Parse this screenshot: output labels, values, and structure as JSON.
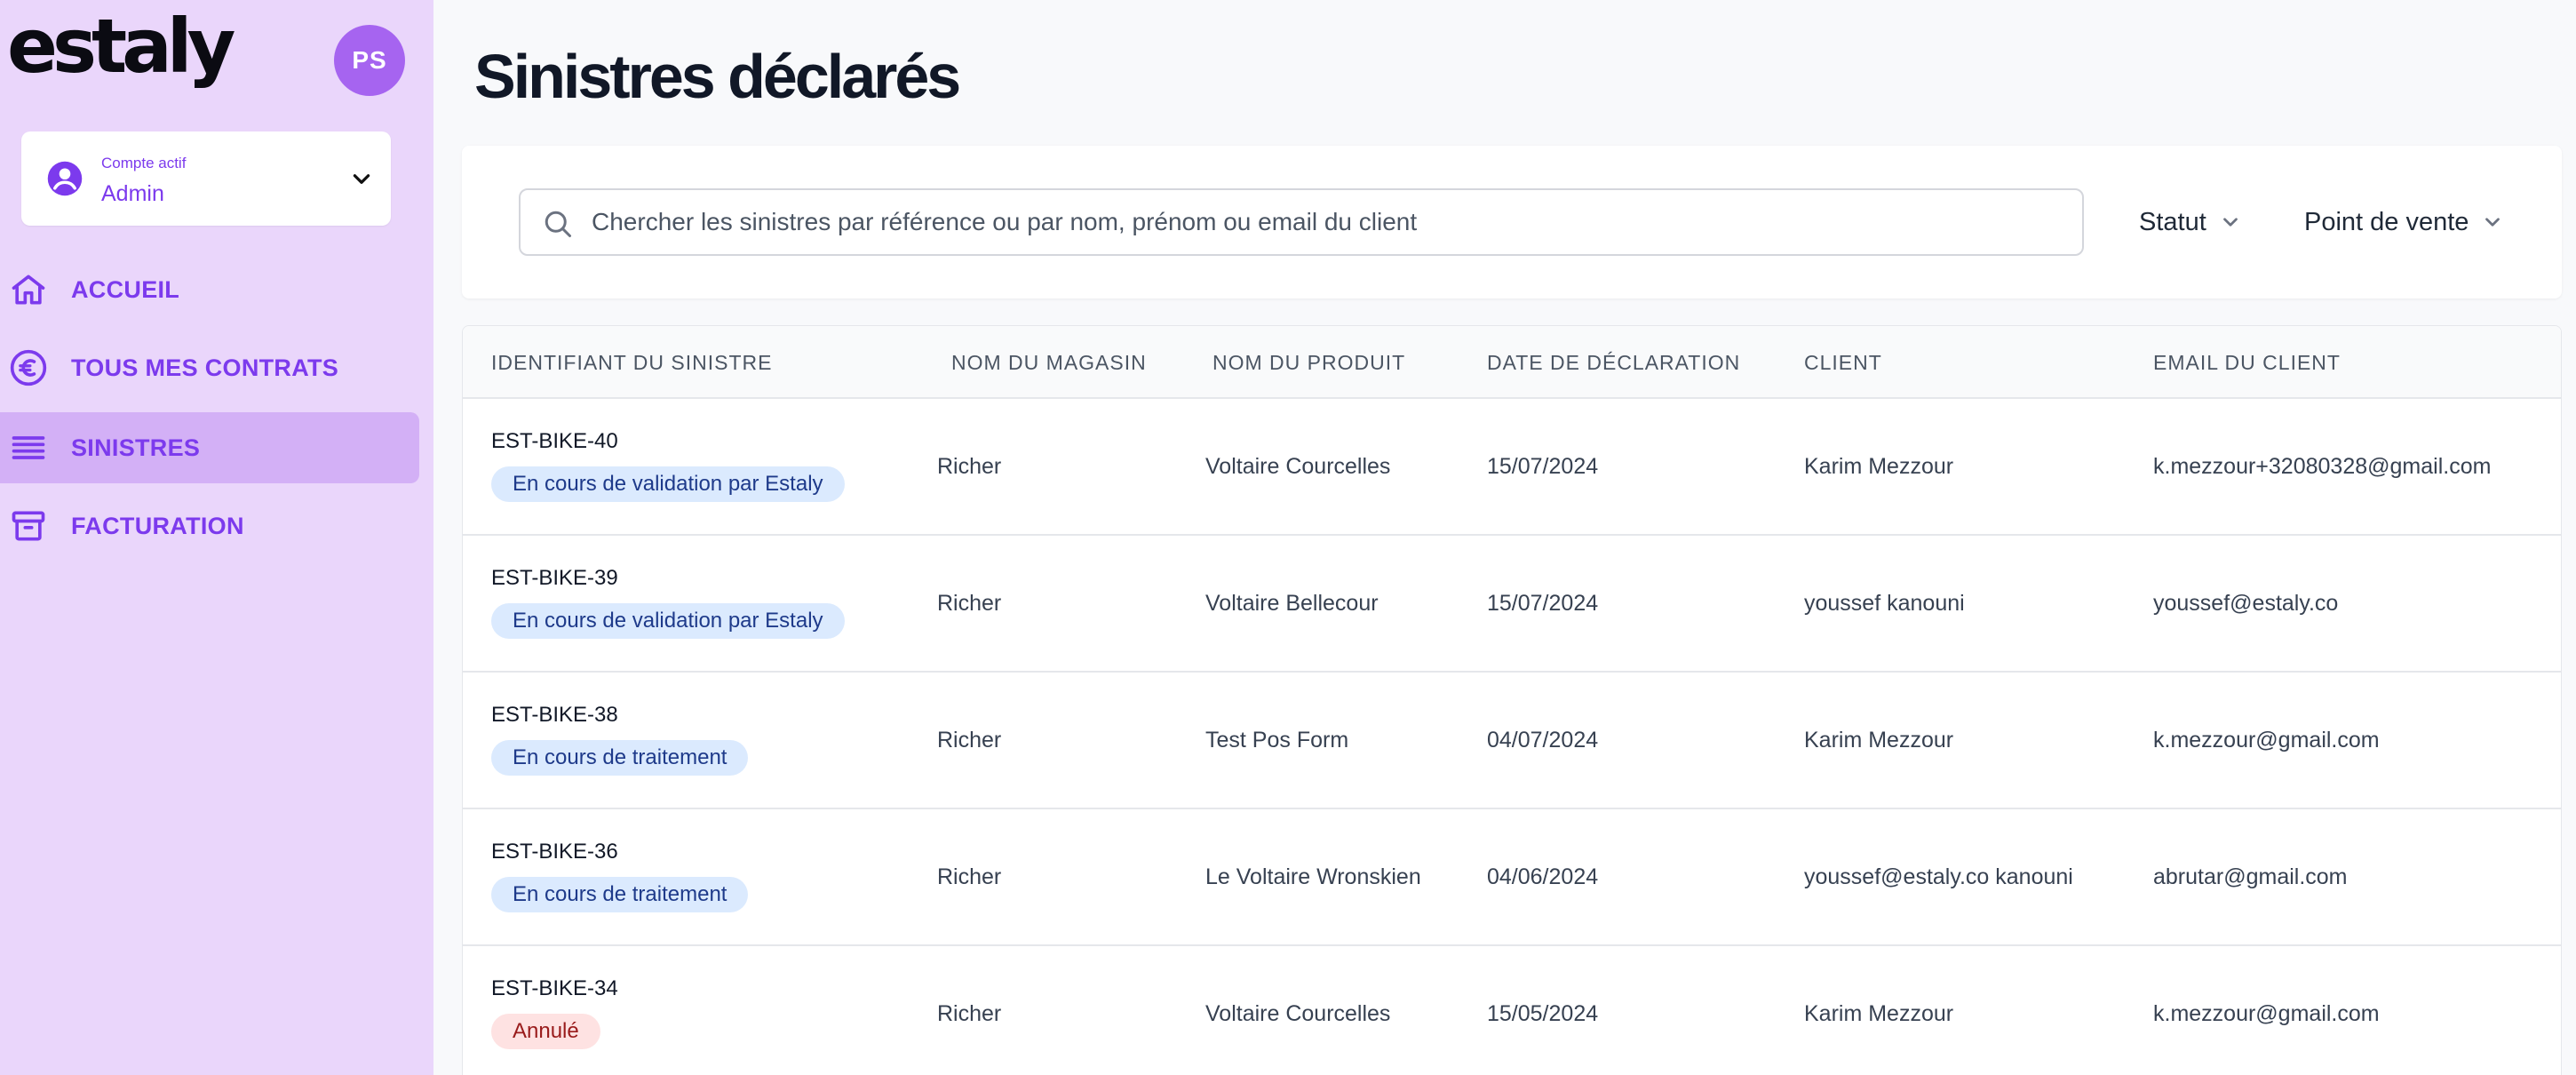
{
  "app": {
    "logo_text": "estaly",
    "avatar_initials": "PS"
  },
  "account": {
    "caption": "Compte actif",
    "value": "Admin"
  },
  "nav": {
    "items": [
      {
        "label": "ACCUEIL",
        "icon": "home-icon"
      },
      {
        "label": "TOUS MES CONTRATS",
        "icon": "euro-icon"
      },
      {
        "label": "SINISTRES",
        "icon": "menu-lines-icon",
        "active": true
      },
      {
        "label": "FACTURATION",
        "icon": "archive-box-icon"
      }
    ]
  },
  "page": {
    "title": "Sinistres déclarés"
  },
  "search": {
    "placeholder": "Chercher les sinistres par référence ou par nom, prénom ou email du client"
  },
  "filters": {
    "status_label": "Statut",
    "pos_label": "Point de vente"
  },
  "table": {
    "headers": {
      "id": "IDENTIFIANT DU SINISTRE",
      "store": "NOM DU MAGASIN",
      "product": "NOM DU PRODUIT",
      "date": "DATE DE DÉCLARATION",
      "client": "CLIENT",
      "email": "EMAIL DU CLIENT"
    },
    "rows": [
      {
        "id": "EST-BIKE-40",
        "status": "En cours de validation par Estaly",
        "store": "Richer",
        "product": "Voltaire Courcelles",
        "date": "15/07/2024",
        "client": "Karim Mezzour",
        "email": "k.mezzour+32080328@gmail.com"
      },
      {
        "id": "EST-BIKE-39",
        "status": "En cours de validation par Estaly",
        "store": "Richer",
        "product": "Voltaire Bellecour",
        "date": "15/07/2024",
        "client": "youssef kanouni",
        "email": "youssef@estaly.co"
      },
      {
        "id": "EST-BIKE-38",
        "status": "En cours de traitement",
        "store": "Richer",
        "product": "Test Pos Form",
        "date": "04/07/2024",
        "client": "Karim Mezzour",
        "email": "k.mezzour@gmail.com"
      },
      {
        "id": "EST-BIKE-36",
        "status": "En cours de traitement",
        "store": "Richer",
        "product": "Le Voltaire Wronskien",
        "date": "04/06/2024",
        "client": "youssef@estaly.co kanouni",
        "email": "abrutar@gmail.com"
      },
      {
        "id": "EST-BIKE-34",
        "status": "Annulé",
        "store": "Richer",
        "product": "Voltaire Courcelles",
        "date": "15/05/2024",
        "client": "Karim Mezzour",
        "email": "k.mezzour@gmail.com"
      }
    ]
  },
  "colors": {
    "accent": "#7c3aed",
    "sidebar_bg": "#ead6fb",
    "sidebar_active": "#d3b0f6",
    "badge_info_bg": "#dbeafe",
    "badge_info_text": "#1e3a8a",
    "badge_cancel_bg": "#fee2e2",
    "badge_cancel_text": "#991b1b"
  }
}
